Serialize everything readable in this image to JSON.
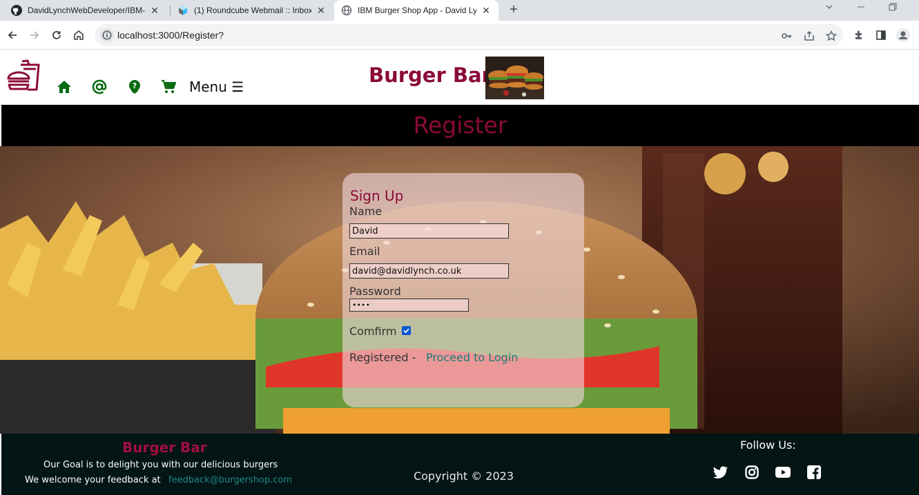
{
  "browser": {
    "tabs": [
      {
        "title": "DavidLynchWebDeveloper/IBM-",
        "icon": "github-icon"
      },
      {
        "title": "(1) Roundcube Webmail :: Inbox",
        "icon": "roundcube-icon"
      },
      {
        "title": "IBM Burger Shop App - David Ly",
        "icon": "globe-icon"
      }
    ],
    "url": "localhost:3000/Register?"
  },
  "header": {
    "brand": "Burger Bar",
    "menu_label": "Menu ☰",
    "nav_icons": [
      "home-icon",
      "at-icon",
      "help-icon",
      "cart-icon"
    ]
  },
  "register": {
    "title": "Register"
  },
  "form": {
    "title": "Sign Up",
    "name_label": "Name",
    "name_value": "David",
    "email_label": "Email",
    "email_value": "david@davidlynch.co.uk",
    "password_label": "Password",
    "password_value": "••••",
    "confirm_label": "Comfirm",
    "confirm_checked": true,
    "registered_text": "Registered -",
    "login_link": "Proceed to Login"
  },
  "footer": {
    "brand": "Burger Bar",
    "goal": "Our Goal is to delight you with our delicious burgers",
    "feedback_text": "We welcome your feedback at",
    "feedback_email": "feedback@burgershop.com",
    "copyright": "Copyright © 2023",
    "follow": "Follow Us:",
    "social_icons": [
      "twitter-icon",
      "instagram-icon",
      "youtube-icon",
      "facebook-icon"
    ]
  },
  "colors": {
    "brand": "#8b0a3a",
    "nav_icon": "#0a6b12",
    "link": "#1e7a74",
    "footer_bg": "#031514"
  }
}
